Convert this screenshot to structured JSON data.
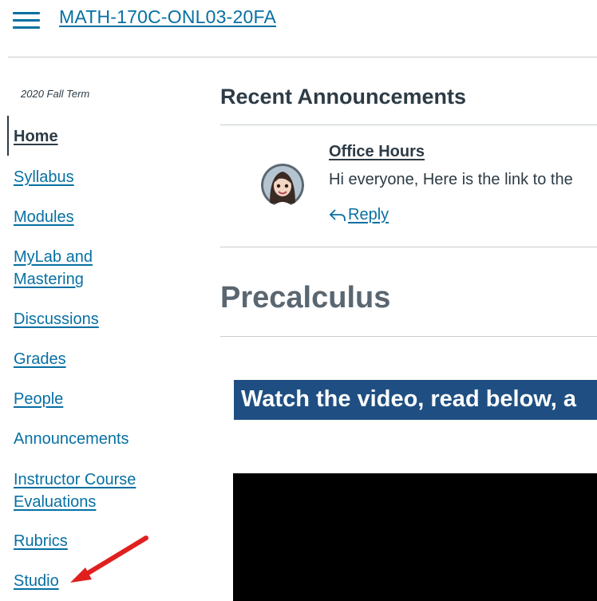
{
  "header": {
    "menu_icon": "hamburger-menu-icon",
    "course_title": "MATH-170C-ONL03-20FA"
  },
  "sidebar": {
    "term": "2020 Fall Term",
    "items": [
      {
        "label": "Home"
      },
      {
        "label": "Syllabus"
      },
      {
        "label": "Modules"
      },
      {
        "label": "MyLab and",
        "label2": "Mastering"
      },
      {
        "label": "Discussions"
      },
      {
        "label": "Grades"
      },
      {
        "label": "People"
      },
      {
        "label": "Announcements"
      },
      {
        "label": "Instructor Course",
        "label2": "Evaluations"
      },
      {
        "label": "Rubrics"
      },
      {
        "label": "Studio"
      }
    ]
  },
  "announcements": {
    "heading": "Recent Announcements",
    "item": {
      "title": "Office Hours",
      "preview": "Hi everyone, Here is the link to the",
      "reply_label": "Reply",
      "reply_icon": "reply-arrow-icon",
      "avatar_icon": "avatar"
    }
  },
  "content": {
    "page_heading": "Precalculus",
    "banner_text": "Watch the video, read below, a"
  },
  "colors": {
    "link": "#0770a3",
    "text": "#2d3b45",
    "banner": "#1f4f82",
    "annotation_arrow": "#e0201f"
  }
}
